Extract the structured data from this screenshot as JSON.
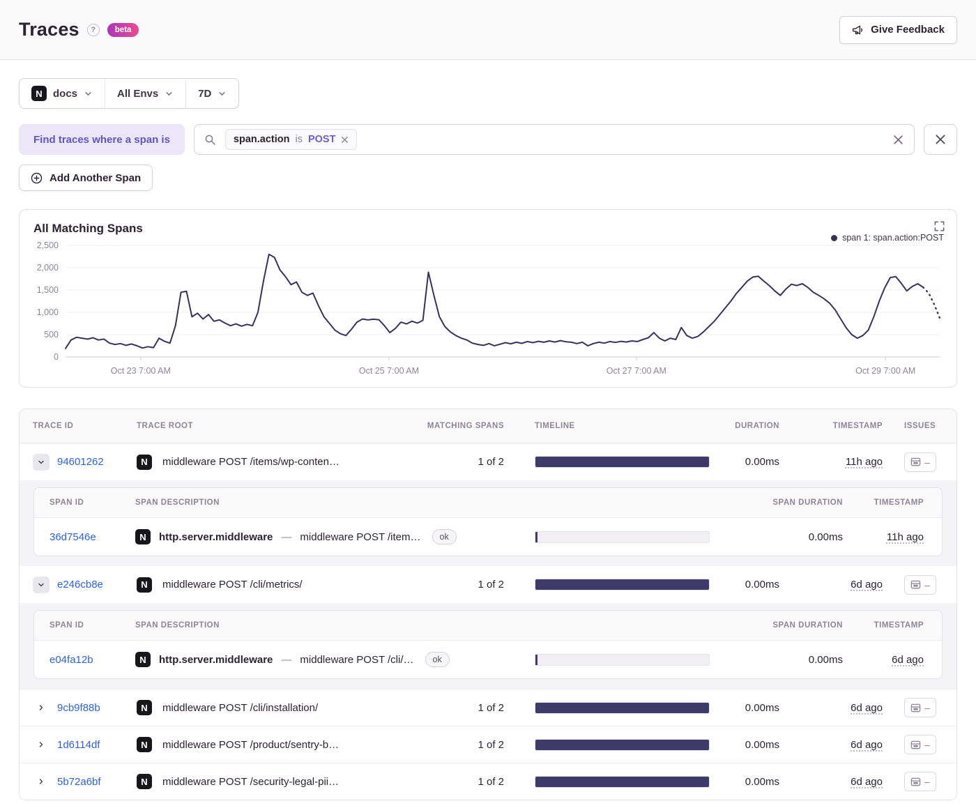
{
  "header": {
    "title": "Traces",
    "help_glyph": "?",
    "beta_label": "beta",
    "feedback_label": "Give Feedback"
  },
  "filters": {
    "project_label": "docs",
    "env_label": "All Envs",
    "period_label": "7D"
  },
  "span_query": {
    "where_label": "Find traces where a span is",
    "token": {
      "key": "span.action",
      "op": "is",
      "value": "POST"
    },
    "add_span_label": "Add Another Span"
  },
  "colors": {
    "line": "#36315f",
    "timeline_fill": "#3e3a6a",
    "link": "#2c63dd",
    "beta_gradient_from": "#a838b6",
    "beta_gradient_to": "#ec4a90"
  },
  "chart_data": {
    "type": "line",
    "title": "All Matching Spans",
    "legend": [
      {
        "label": "span 1: span.action:POST",
        "color": "#36315f"
      }
    ],
    "legend_position": "top-right",
    "grid": true,
    "xlabel": "",
    "ylabel": "",
    "ylim": [
      0,
      2500
    ],
    "y_ticks": [
      0,
      500,
      1000,
      1500,
      2000,
      2500
    ],
    "y_tick_labels": [
      "0",
      "500",
      "1,000",
      "1,500",
      "2,000",
      "2,500"
    ],
    "x_ticks": [
      {
        "label": "Oct 23 7:00 AM",
        "frac": 0.086
      },
      {
        "label": "Oct 25 7:00 AM",
        "frac": 0.37
      },
      {
        "label": "Oct 27 7:00 AM",
        "frac": 0.653
      },
      {
        "label": "Oct 29 7:00 AM",
        "frac": 0.938
      }
    ],
    "dotted_tail_points": 3,
    "values": [
      190,
      380,
      440,
      420,
      400,
      430,
      380,
      400,
      310,
      280,
      300,
      260,
      290,
      250,
      200,
      230,
      210,
      420,
      350,
      310,
      700,
      1450,
      1470,
      900,
      980,
      850,
      950,
      800,
      830,
      760,
      700,
      740,
      690,
      730,
      700,
      1000,
      1700,
      2300,
      2230,
      1950,
      1800,
      1620,
      1680,
      1450,
      1380,
      1430,
      1150,
      900,
      750,
      600,
      520,
      480,
      620,
      780,
      850,
      830,
      845,
      835,
      700,
      545,
      640,
      780,
      740,
      800,
      760,
      820,
      1900,
      1380,
      900,
      680,
      560,
      480,
      420,
      380,
      310,
      280,
      260,
      300,
      250,
      285,
      320,
      295,
      330,
      305,
      345,
      320,
      350,
      330,
      360,
      335,
      365,
      340,
      330,
      300,
      330,
      250,
      300,
      330,
      310,
      345,
      325,
      350,
      335,
      360,
      345,
      390,
      430,
      545,
      420,
      360,
      420,
      390,
      660,
      480,
      420,
      460,
      560,
      680,
      800,
      950,
      1100,
      1250,
      1420,
      1560,
      1700,
      1790,
      1810,
      1700,
      1600,
      1480,
      1380,
      1520,
      1630,
      1600,
      1640,
      1560,
      1450,
      1380,
      1300,
      1200,
      1050,
      850,
      650,
      500,
      420,
      480,
      600,
      900,
      1250,
      1550,
      1780,
      1800,
      1650,
      1480,
      1580,
      1640,
      1560,
      1430,
      1180,
      870
    ]
  },
  "table": {
    "columns": [
      "TRACE ID",
      "TRACE ROOT",
      "MATCHING SPANS",
      "TIMELINE",
      "DURATION",
      "TIMESTAMP",
      "ISSUES"
    ],
    "span_columns": [
      "SPAN ID",
      "SPAN DESCRIPTION",
      "SPAN DURATION",
      "TIMESTAMP"
    ],
    "project_badge": "N",
    "rows": [
      {
        "id": "94601262",
        "root": "middleware POST /items/wp-conten…",
        "matching": "1 of 2",
        "duration": "0.00ms",
        "timestamp": "11h ago",
        "issues": "–",
        "expanded": true,
        "spans": [
          {
            "id": "36d7546e",
            "op": "http.server.middleware",
            "dash": "—",
            "desc": "middleware POST /item…",
            "status": "ok",
            "duration": "0.00ms",
            "timestamp": "11h ago"
          }
        ]
      },
      {
        "id": "e246cb8e",
        "root": "middleware POST /cli/metrics/",
        "matching": "1 of 2",
        "duration": "0.00ms",
        "timestamp": "6d ago",
        "issues": "–",
        "expanded": true,
        "spans": [
          {
            "id": "e04fa12b",
            "op": "http.server.middleware",
            "dash": "—",
            "desc": "middleware POST /cli/…",
            "status": "ok",
            "duration": "0.00ms",
            "timestamp": "6d ago"
          }
        ]
      },
      {
        "id": "9cb9f88b",
        "root": "middleware POST /cli/installation/",
        "matching": "1 of 2",
        "duration": "0.00ms",
        "timestamp": "6d ago",
        "issues": "–",
        "expanded": false
      },
      {
        "id": "1d6114df",
        "root": "middleware POST /product/sentry-b…",
        "matching": "1 of 2",
        "duration": "0.00ms",
        "timestamp": "6d ago",
        "issues": "–",
        "expanded": false
      },
      {
        "id": "5b72a6bf",
        "root": "middleware POST /security-legal-pii…",
        "matching": "1 of 2",
        "duration": "0.00ms",
        "timestamp": "6d ago",
        "issues": "–",
        "expanded": false
      }
    ]
  }
}
